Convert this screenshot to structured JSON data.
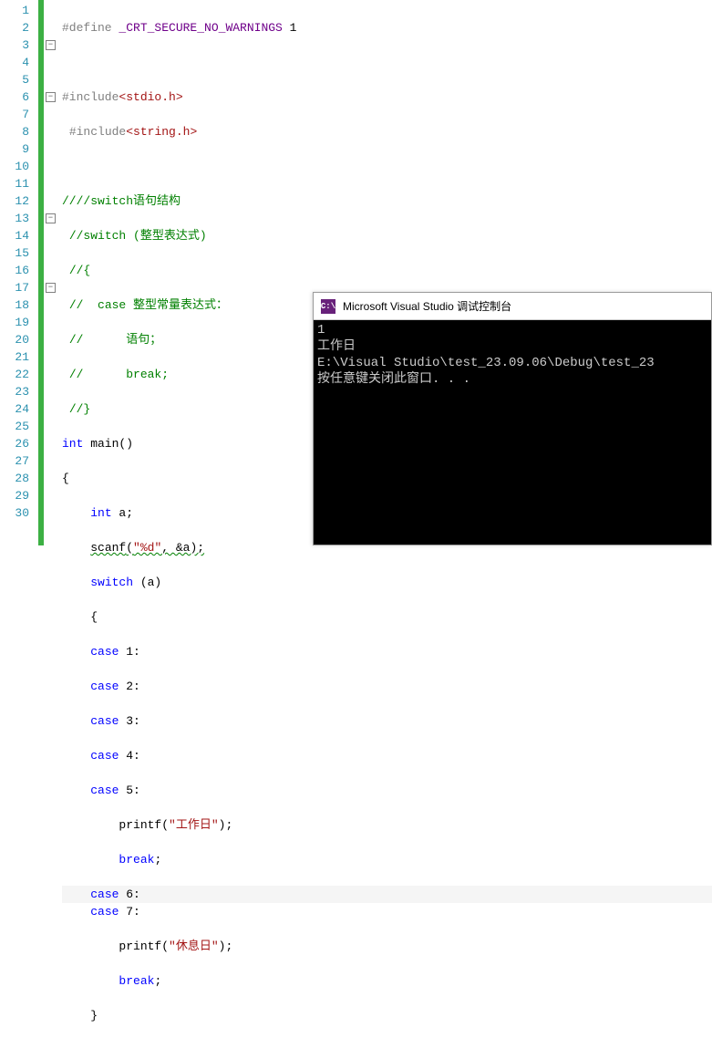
{
  "lines": {
    "count": 30,
    "fold": {
      "l3": "−",
      "l6": "−",
      "l13": "−",
      "l17": "−"
    }
  },
  "code": {
    "l1": {
      "pp": "#define ",
      "mac": "_CRT_SECURE_NO_WARNINGS",
      "rest": " 1"
    },
    "l3": {
      "pp": "#include",
      "ang": "<stdio.h>"
    },
    "l4": {
      "pp": "#include",
      "ang": "<string.h>"
    },
    "l6": {
      "cmt": "////switch语句结构"
    },
    "l7": {
      "cmt": "//switch (整型表达式)"
    },
    "l8": {
      "cmt": "//{"
    },
    "l9": {
      "cmt": "//  case 整型常量表达式："
    },
    "l10": {
      "cmt": "//      语句；"
    },
    "l11": {
      "cmt": "//      break;"
    },
    "l12": {
      "cmt": "//}"
    },
    "l13": {
      "kw1": "int",
      "fn": " main()"
    },
    "l14": {
      "txt": "{"
    },
    "l15": {
      "kw1": "int",
      "rest": " a;"
    },
    "l16": {
      "fn": "scanf",
      "paren1": "(",
      "str": "\"%d\"",
      "rest": ", &a);"
    },
    "l17": {
      "kw1": "switch",
      "rest": " (a)"
    },
    "l18": {
      "txt": "{"
    },
    "l19": {
      "kw1": "case",
      "rest": " 1:"
    },
    "l20": {
      "kw1": "case",
      "rest": " 2:"
    },
    "l21": {
      "kw1": "case",
      "rest": " 3:"
    },
    "l22": {
      "kw1": "case",
      "rest": " 4:"
    },
    "l23": {
      "kw1": "case",
      "rest": " 5:"
    },
    "l24": {
      "fn": "printf",
      "paren1": "(",
      "str": "\"工作日\"",
      "rest": ");"
    },
    "l25": {
      "kw1": "break",
      "rest": ";"
    },
    "l26": {
      "kw1": "case",
      "rest": " 6:"
    },
    "l27": {
      "kw1": "case",
      "rest": " 7:"
    },
    "l28": {
      "fn": "printf",
      "paren1": "(",
      "str": "\"休息日\"",
      "rest": ");"
    },
    "l29": {
      "kw1": "break",
      "rest": ";"
    },
    "l30": {
      "txt": "}"
    }
  },
  "console": {
    "icon": "C:\\",
    "title": "Microsoft Visual Studio 调试控制台",
    "out1": "1",
    "out2": "工作日",
    "out3": "E:\\Visual Studio\\test_23.09.06\\Debug\\test_23",
    "out4": "按任意键关闭此窗口. . ."
  }
}
